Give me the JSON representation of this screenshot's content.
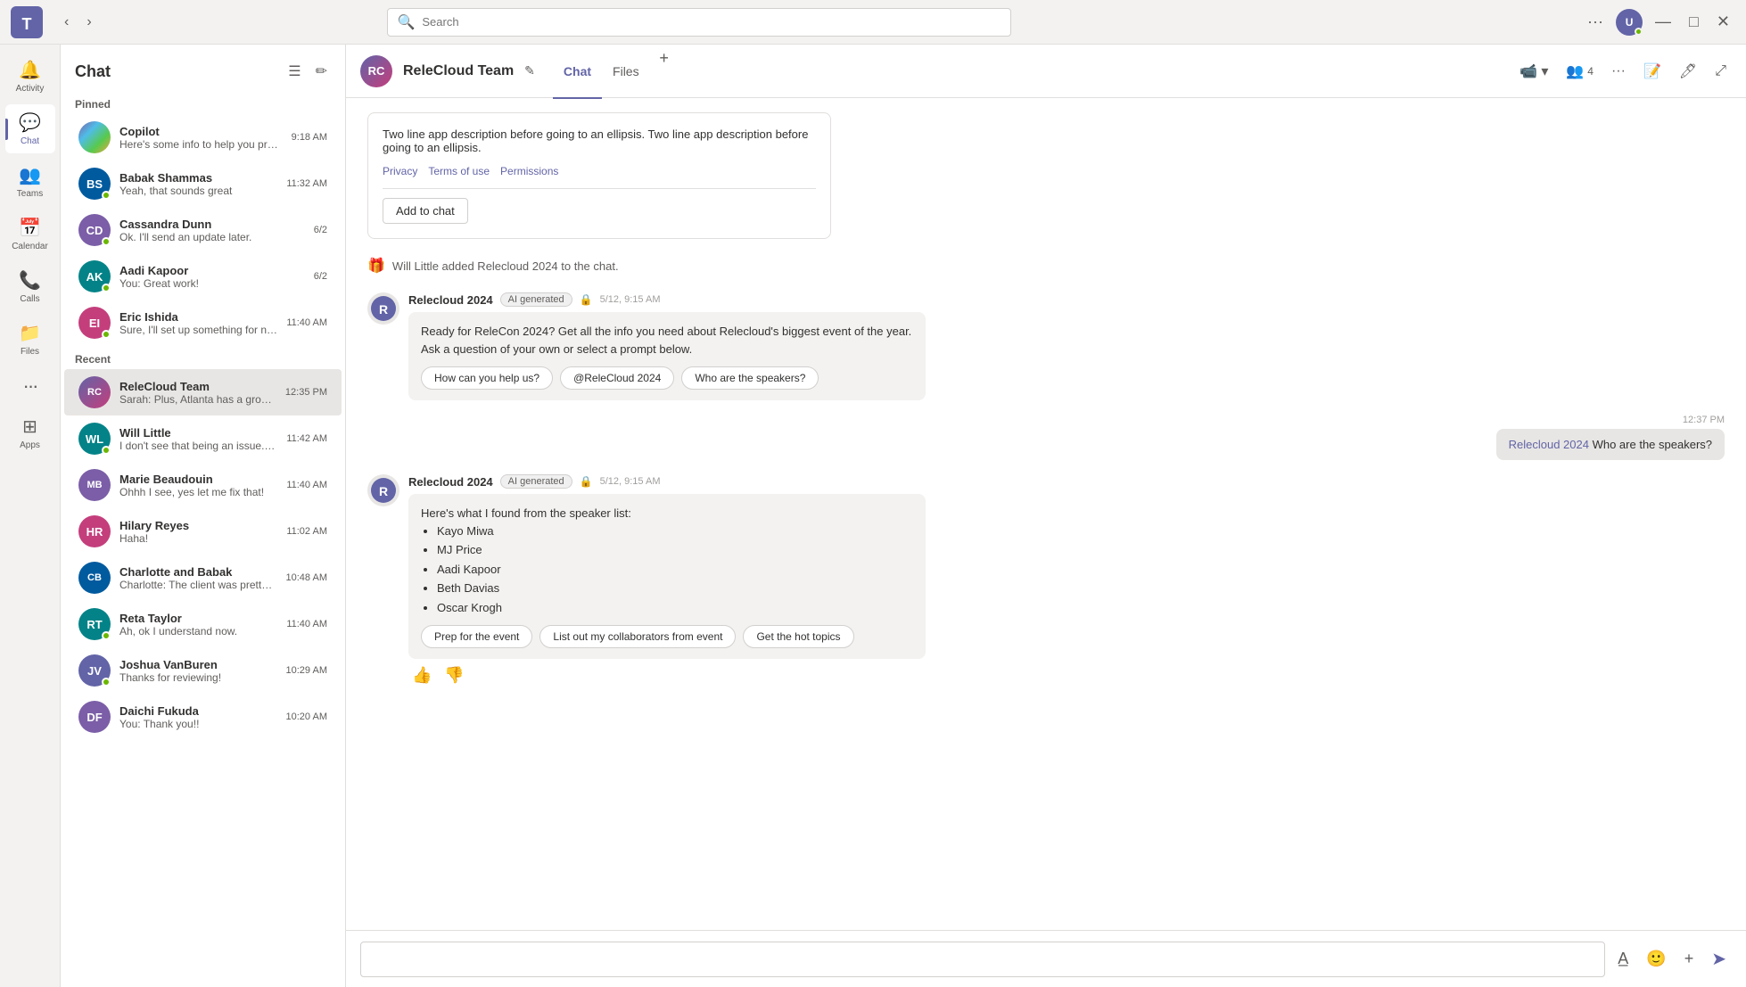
{
  "app": {
    "title": "Microsoft Teams"
  },
  "titlebar": {
    "back_label": "‹",
    "forward_label": "›",
    "search_placeholder": "Search",
    "more_label": "···",
    "minimize_label": "—",
    "maximize_label": "□",
    "close_label": "✕"
  },
  "left_nav": {
    "items": [
      {
        "id": "activity",
        "label": "Activity",
        "icon": "🔔"
      },
      {
        "id": "chat",
        "label": "Chat",
        "icon": "💬",
        "active": true
      },
      {
        "id": "teams",
        "label": "Teams",
        "icon": "👥"
      },
      {
        "id": "calendar",
        "label": "Calendar",
        "icon": "📅"
      },
      {
        "id": "calls",
        "label": "Calls",
        "icon": "📞"
      },
      {
        "id": "files",
        "label": "Files",
        "icon": "📁"
      },
      {
        "id": "more",
        "label": "···",
        "icon": "···"
      },
      {
        "id": "apps",
        "label": "Apps",
        "icon": "⊞"
      }
    ]
  },
  "sidebar": {
    "title": "Chat",
    "sections": {
      "pinned_label": "Pinned",
      "recent_label": "Recent"
    },
    "pinned": [
      {
        "id": "copilot",
        "name": "Copilot",
        "preview": "Here's some info to help you prep for your...",
        "time": "9:18 AM",
        "avatar_class": "av-copilot",
        "initials": ""
      },
      {
        "id": "babak",
        "name": "Babak Shammas",
        "preview": "Yeah, that sounds great",
        "time": "11:32 AM",
        "avatar_class": "av-babak",
        "initials": "BS"
      },
      {
        "id": "cassandra",
        "name": "Cassandra Dunn",
        "preview": "Ok. I'll send an update later.",
        "time": "6/2",
        "avatar_class": "av-cassandra",
        "initials": "CD"
      },
      {
        "id": "aadi",
        "name": "Aadi Kapoor",
        "preview": "You: Great work!",
        "time": "6/2",
        "avatar_class": "av-aadi",
        "initials": "AK"
      },
      {
        "id": "eric",
        "name": "Eric Ishida",
        "preview": "Sure, I'll set up something for next week t...",
        "time": "11:40 AM",
        "avatar_class": "av-eric",
        "initials": "EI"
      }
    ],
    "recent": [
      {
        "id": "relecloud",
        "name": "ReleCloud Team",
        "preview": "Sarah: Plus, Atlanta has a growing tech ...",
        "time": "12:35 PM",
        "avatar_class": "av-relecloud",
        "initials": "RC",
        "active": true
      },
      {
        "id": "will",
        "name": "Will Little",
        "preview": "I don't see that being an issue. Can you ta...",
        "time": "11:42 AM",
        "avatar_class": "av-will",
        "initials": "WL"
      },
      {
        "id": "marie",
        "name": "Marie Beaudouin",
        "preview": "Ohhh I see, yes let me fix that!",
        "time": "11:40 AM",
        "avatar_class": "av-mb",
        "initials": "MB"
      },
      {
        "id": "hilary",
        "name": "Hilary Reyes",
        "preview": "Haha!",
        "time": "11:02 AM",
        "avatar_class": "av-hilary",
        "initials": "HR"
      },
      {
        "id": "charlotte",
        "name": "Charlotte and Babak",
        "preview": "Charlotte: The client was pretty happy with...",
        "time": "10:48 AM",
        "avatar_class": "av-charlotte",
        "initials": "CB"
      },
      {
        "id": "reta",
        "name": "Reta Taylor",
        "preview": "Ah, ok I understand now.",
        "time": "11:40 AM",
        "avatar_class": "av-reta",
        "initials": "RT"
      },
      {
        "id": "joshua",
        "name": "Joshua VanBuren",
        "preview": "Thanks for reviewing!",
        "time": "10:29 AM",
        "avatar_class": "av-joshua",
        "initials": "JV"
      },
      {
        "id": "daichi",
        "name": "Daichi Fukuda",
        "preview": "You: Thank you!!",
        "time": "10:20 AM",
        "avatar_class": "av-daichi",
        "initials": "DF"
      }
    ]
  },
  "chat_header": {
    "group_name": "ReleCloud Team",
    "tabs": [
      {
        "id": "chat",
        "label": "Chat",
        "active": true
      },
      {
        "id": "files",
        "label": "Files",
        "active": false
      }
    ],
    "add_tab_label": "+",
    "people_count": "4",
    "edit_label": "✎"
  },
  "messages": {
    "app_card": {
      "description": "Two line app description before going to an ellipsis. Two line app description before going to an ellipsis.",
      "privacy_label": "Privacy",
      "terms_label": "Terms of use",
      "permissions_label": "Permissions",
      "add_button": "Add to chat"
    },
    "system_msg": "Will Little added Relecloud 2024 to the chat.",
    "bot_msg1": {
      "sender": "Relecloud 2024",
      "ai_badge": "AI generated",
      "time": "5/12, 9:15 AM",
      "text": "Ready for ReleCon 2024? Get all the info you need about Relecloud's biggest event of the year. Ask a question of your own or select a prompt below.",
      "prompts": [
        "How can you help us?",
        "@ReleCloud 2024",
        "Who are the speakers?"
      ]
    },
    "user_msg": {
      "time": "12:37 PM",
      "mention": "Relecloud 2024",
      "text": " Who are the speakers?"
    },
    "bot_msg2": {
      "sender": "Relecloud 2024",
      "ai_badge": "AI generated",
      "time": "5/12, 9:15 AM",
      "intro": "Here's what I found from the speaker list:",
      "speakers": [
        "Kayo Miwa",
        "MJ Price",
        "Aadi Kapoor",
        "Beth Davias",
        "Oscar Krogh"
      ],
      "prompts": [
        "Prep for the event",
        "List out my collaborators from event",
        "Get the hot topics"
      ]
    }
  },
  "compose": {
    "placeholder": ""
  }
}
